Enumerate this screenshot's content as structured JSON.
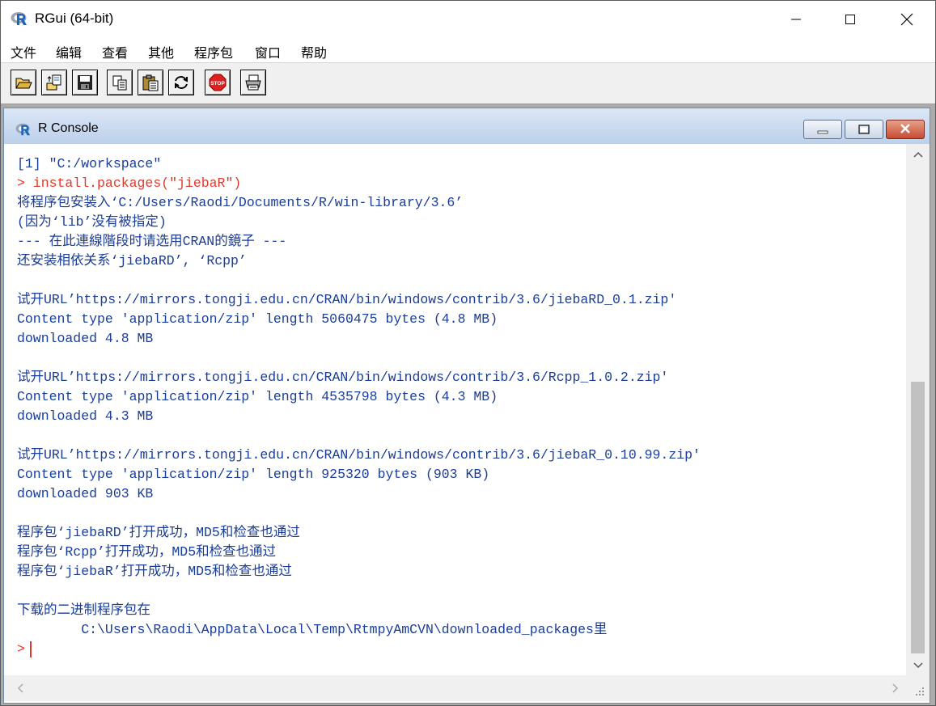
{
  "app": {
    "title": "RGui (64-bit)",
    "icon": "r-logo-icon"
  },
  "window_controls": {
    "minimize_icon": "minimize-icon",
    "maximize_icon": "maximize-icon",
    "close_icon": "close-icon"
  },
  "menu": {
    "items": [
      "文件",
      "编辑",
      "查看",
      "其他",
      "程序包",
      "窗口",
      "帮助"
    ]
  },
  "toolbar": {
    "buttons": [
      "open-script-icon",
      "load-workspace-icon",
      "save-workspace-icon",
      "copy-icon",
      "paste-icon",
      "refresh-icon",
      "stop-icon",
      "print-icon"
    ],
    "stop_label": "STOP"
  },
  "console": {
    "title": "R Console",
    "lines": [
      {
        "text": "[1] \"C:/workspace\"",
        "type": "output"
      },
      {
        "text": "> install.packages(\"jiebaR\")",
        "type": "cmd"
      },
      {
        "text": "将程序包安装入‘C:/Users/Raodi/Documents/R/win-library/3.6’",
        "type": "output"
      },
      {
        "text": "(因为‘lib’没有被指定)",
        "type": "output"
      },
      {
        "text": "--- 在此連線階段时请选用CRAN的鏡子 ---",
        "type": "output"
      },
      {
        "text": "还安装相依关系‘jiebaRD’, ‘Rcpp’",
        "type": "output"
      },
      {
        "text": "",
        "type": "output"
      },
      {
        "text": "试开URL’https://mirrors.tongji.edu.cn/CRAN/bin/windows/contrib/3.6/jiebaRD_0.1.zip'",
        "type": "output"
      },
      {
        "text": "Content type 'application/zip' length 5060475 bytes (4.8 MB)",
        "type": "output"
      },
      {
        "text": "downloaded 4.8 MB",
        "type": "output"
      },
      {
        "text": "",
        "type": "output"
      },
      {
        "text": "试开URL’https://mirrors.tongji.edu.cn/CRAN/bin/windows/contrib/3.6/Rcpp_1.0.2.zip'",
        "type": "output"
      },
      {
        "text": "Content type 'application/zip' length 4535798 bytes (4.3 MB)",
        "type": "output"
      },
      {
        "text": "downloaded 4.3 MB",
        "type": "output"
      },
      {
        "text": "",
        "type": "output"
      },
      {
        "text": "试开URL’https://mirrors.tongji.edu.cn/CRAN/bin/windows/contrib/3.6/jiebaR_0.10.99.zip'",
        "type": "output"
      },
      {
        "text": "Content type 'application/zip' length 925320 bytes (903 KB)",
        "type": "output"
      },
      {
        "text": "downloaded 903 KB",
        "type": "output"
      },
      {
        "text": "",
        "type": "output"
      },
      {
        "text": "程序包‘jiebaRD’打开成功，MD5和检查也通过",
        "type": "output"
      },
      {
        "text": "程序包‘Rcpp’打开成功，MD5和检查也通过",
        "type": "output"
      },
      {
        "text": "程序包‘jiebaR’打开成功，MD5和检查也通过",
        "type": "output"
      },
      {
        "text": "",
        "type": "output"
      },
      {
        "text": "下载的二进制程序包在",
        "type": "output"
      },
      {
        "text": "        C:\\Users\\Raodi\\AppData\\Local\\Temp\\RtmpyAmCVN\\downloaded_packages里",
        "type": "output"
      }
    ],
    "prompt": ">"
  },
  "colors": {
    "output_text": "#1a3d9a",
    "command_text": "#e0392b"
  }
}
